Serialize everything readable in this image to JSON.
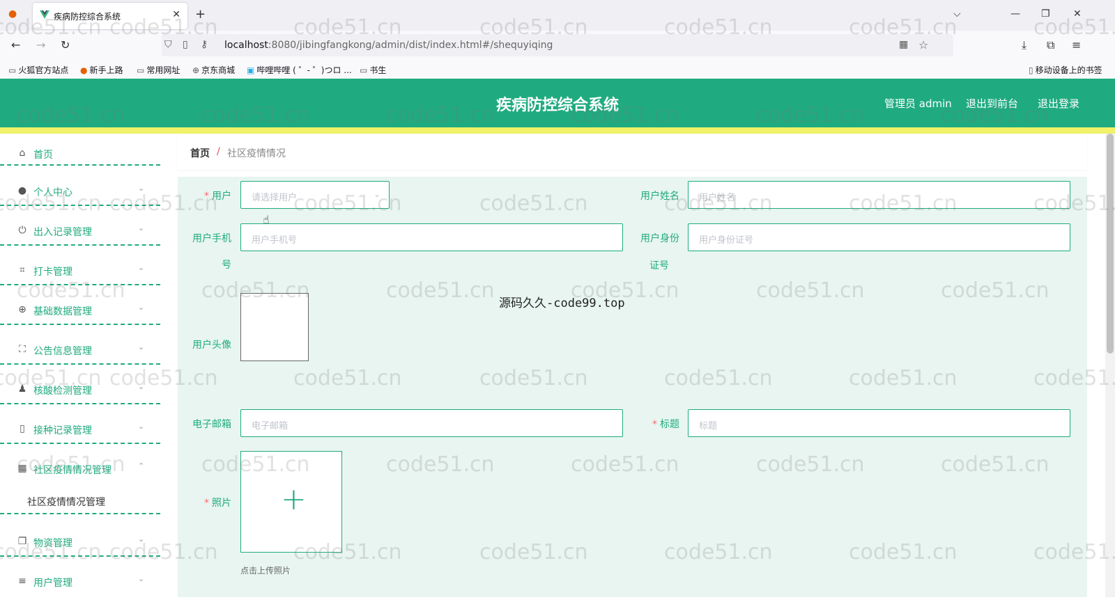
{
  "browser": {
    "tab_title": "疾病防控综合系统",
    "url_host": "localhost",
    "url_rest": ":8080/jibingfangkong/admin/dist/index.html#/shequyiqing",
    "bookmarks": [
      "火狐官方站点",
      "新手上路",
      "常用网址",
      "京东商城",
      "哔哩哔哩 ( ゜- ゜)つロ ...",
      "书生"
    ],
    "mobile_bookmarks": "移动设备上的书签"
  },
  "header": {
    "title": "疾病防控综合系统",
    "user_label": "管理员 admin",
    "front_link": "退出到前台",
    "logout_link": "退出登录",
    "bg_color": "#1fab7f",
    "accent_bar_color": "#f1f16a"
  },
  "sidebar": {
    "items": [
      {
        "label": "首页",
        "icon": "home-icon",
        "has_chevron": false
      },
      {
        "label": "个人中心",
        "icon": "user-icon",
        "has_chevron": true
      },
      {
        "label": "出入记录管理",
        "icon": "power-icon",
        "has_chevron": true
      },
      {
        "label": "打卡管理",
        "icon": "crop-icon",
        "has_chevron": true
      },
      {
        "label": "基础数据管理",
        "icon": "globe-icon",
        "has_chevron": true
      },
      {
        "label": "公告信息管理",
        "icon": "fullscreen-icon",
        "has_chevron": true
      },
      {
        "label": "核酸检测管理",
        "icon": "person-stamp-icon",
        "has_chevron": true
      },
      {
        "label": "接种记录管理",
        "icon": "phone-icon",
        "has_chevron": true
      },
      {
        "label": "社区疫情情况管理",
        "icon": "grid-icon",
        "has_chevron": true,
        "expanded": true
      },
      {
        "label": "物资管理",
        "icon": "copy-icon",
        "has_chevron": true
      },
      {
        "label": "用户管理",
        "icon": "menu-icon",
        "has_chevron": true
      }
    ],
    "sub_item": "社区疫情情况管理"
  },
  "breadcrumb": {
    "home": "首页",
    "separator": "/",
    "current": "社区疫情情况"
  },
  "form": {
    "user_label": "用户",
    "user_placeholder": "请选择用户",
    "name_label": "用户姓名",
    "name_placeholder": "用户姓名",
    "phone_label_1": "用户手机",
    "phone_label_2": "号",
    "phone_placeholder": "用户手机号",
    "idcard_label_1": "用户身份",
    "idcard_label_2": "证号",
    "idcard_placeholder": "用户身份证号",
    "avatar_label": "用户头像",
    "email_label": "电子邮箱",
    "email_placeholder": "电子邮箱",
    "title_label": "标题",
    "title_placeholder": "标题",
    "photo_label": "照片",
    "photo_tip": "点击上传照片",
    "required_mark": "*"
  },
  "center_mark": "源码久久-code99.top",
  "watermark": "code51.cn"
}
